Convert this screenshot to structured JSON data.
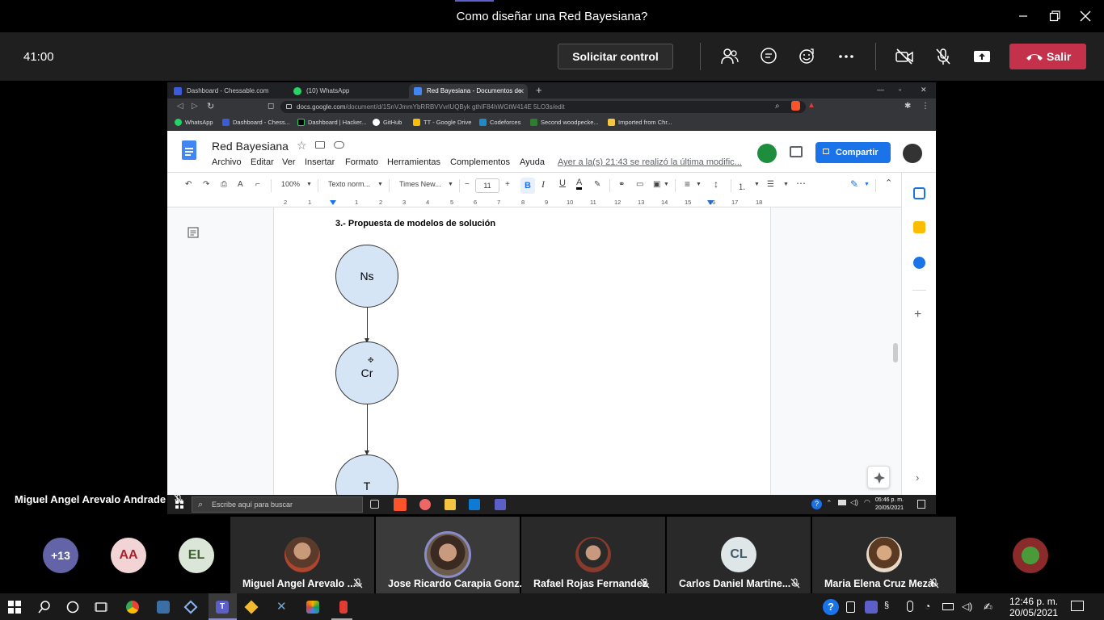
{
  "window": {
    "title": "Como diseñar una Red Bayesiana?"
  },
  "meeting": {
    "timer": "41:00",
    "request_control_label": "Solicitar control",
    "leave_label": "Salir",
    "leave_color": "#c4314b",
    "presenter_name": "Miguel Angel Arevalo Andrade"
  },
  "browser": {
    "tabs": [
      {
        "label": "Dashboard - Chessable.com"
      },
      {
        "label": "(10) WhatsApp"
      },
      {
        "label": "Red Bayesiana - Documentos de"
      }
    ],
    "url_domain": "docs.google.com",
    "url_path": "/document/d/1SnVJmmYbRRBVVvrlUQByk gthIF84hWGtW414E 5LO3s/edit",
    "bookmarks": [
      {
        "label": "WhatsApp"
      },
      {
        "label": "Dashboard - Chess..."
      },
      {
        "label": "Dashboard | Hacker..."
      },
      {
        "label": "GitHub"
      },
      {
        "label": "TT - Google Drive"
      },
      {
        "label": "Codeforces"
      },
      {
        "label": "Second woodpecke..."
      },
      {
        "label": "Imported from Chr..."
      }
    ]
  },
  "docs": {
    "title": "Red Bayesiana",
    "menu": [
      "Archivo",
      "Editar",
      "Ver",
      "Insertar",
      "Formato",
      "Herramientas",
      "Complementos",
      "Ayuda"
    ],
    "last_edit": "Ayer a la(s) 21:43 se realizó la última modific...",
    "share_label": "Compartir",
    "share_color": "#1a73e8",
    "toolbar": {
      "zoom": "100%",
      "style": "Texto norm...",
      "font": "Times New...",
      "font_size": "11"
    },
    "ruler_numbers": [
      "2",
      "1",
      "1",
      "2",
      "3",
      "4",
      "5",
      "6",
      "7",
      "8",
      "9",
      "10",
      "11",
      "12",
      "13",
      "14",
      "15",
      "16",
      "17",
      "18"
    ],
    "heading": "3.- Propuesta de modelos de solución",
    "nodes": [
      {
        "label": "Ns"
      },
      {
        "label": "Cr"
      },
      {
        "label": "T"
      }
    ],
    "node_fill": "#d5e5f6"
  },
  "remote_taskbar": {
    "search_placeholder": "Escribe aquí para buscar",
    "time": "05:46 p. m.",
    "date": "20/05/2021"
  },
  "participants": {
    "overflow": "+13",
    "initials": [
      {
        "text": "AA",
        "color": "#f2d4d7"
      },
      {
        "text": "EL",
        "color": "#dbe5d8"
      }
    ],
    "tiles": [
      {
        "name": "Miguel Angel Arevalo ..."
      },
      {
        "name": "Jose Ricardo Carapia Gonz..."
      },
      {
        "name": "Rafael Rojas Fernandez"
      },
      {
        "name": "Carlos Daniel Martine..."
      },
      {
        "name": "Maria Elena Cruz Meza"
      }
    ],
    "cl_initials": "CL"
  },
  "taskbar": {
    "time": "12:46 p. m.",
    "date": "20/05/2021"
  }
}
